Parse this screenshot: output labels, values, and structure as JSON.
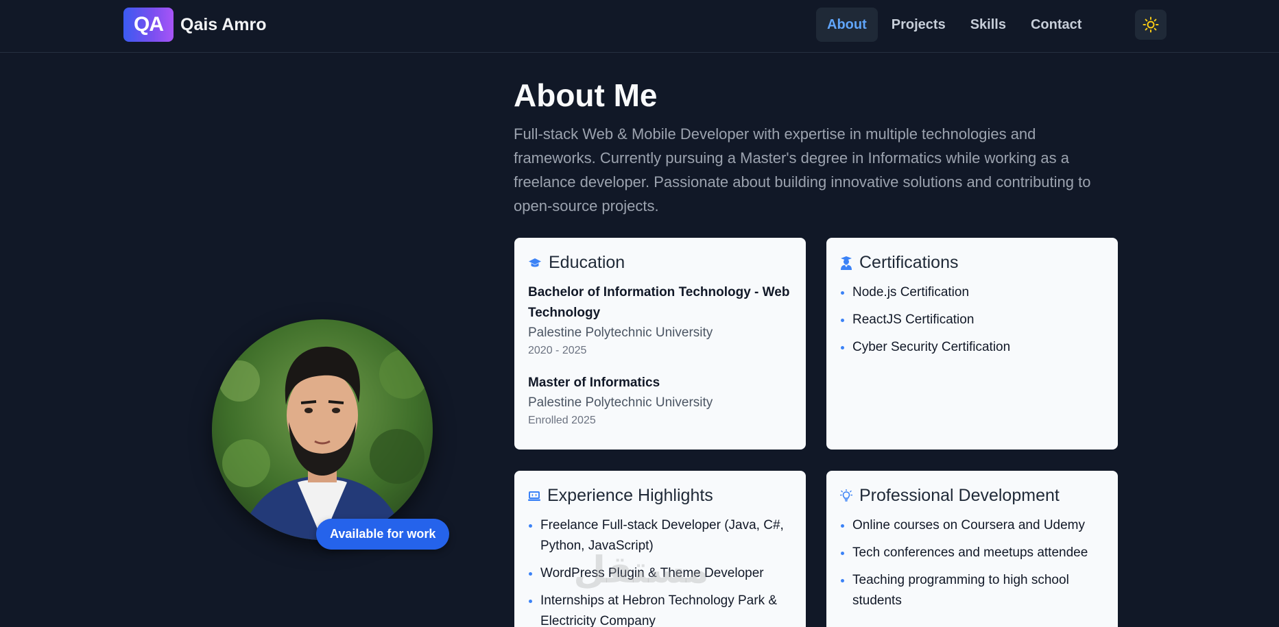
{
  "header": {
    "logo_text": "QA",
    "brand_name": "Qais Amro",
    "nav": [
      {
        "label": "About",
        "active": true
      },
      {
        "label": "Projects",
        "active": false
      },
      {
        "label": "Skills",
        "active": false
      },
      {
        "label": "Contact",
        "active": false
      }
    ],
    "theme_icon": "sun-icon"
  },
  "profile": {
    "availability_label": "Available for work"
  },
  "about": {
    "title": "About Me",
    "description": "Full-stack Web & Mobile Developer with expertise in multiple technologies and frameworks. Currently pursuing a Master's degree in Informatics while working as a freelance developer. Passionate about building innovative solutions and contributing to open-source projects."
  },
  "education": {
    "title": "Education",
    "icon": "graduation-cap-icon",
    "items": [
      {
        "degree": "Bachelor of Information Technology - Web Technology",
        "school": "Palestine Polytechnic University",
        "dates": "2020 - 2025"
      },
      {
        "degree": "Master of Informatics",
        "school": "Palestine Polytechnic University",
        "dates": "Enrolled 2025"
      }
    ]
  },
  "certifications": {
    "title": "Certifications",
    "icon": "user-graduate-icon",
    "items": [
      "Node.js Certification",
      "ReactJS Certification",
      "Cyber Security Certification"
    ]
  },
  "experience": {
    "title": "Experience Highlights",
    "icon": "laptop-icon",
    "items": [
      "Freelance Full-stack Developer (Java, C#, Python, JavaScript)",
      "WordPress Plugin & Theme Developer",
      "Internships at Hebron Technology Park & Electricity Company"
    ]
  },
  "development": {
    "title": "Professional Development",
    "icon": "lightbulb-icon",
    "items": [
      "Online courses on Coursera and Udemy",
      "Tech conferences and meetups attendee",
      "Teaching programming to high school students"
    ]
  },
  "watermark": "مستقل",
  "colors": {
    "background": "#111827",
    "accent": "#2563eb",
    "link_active": "#60a5fa",
    "card": "#f8fafc"
  }
}
